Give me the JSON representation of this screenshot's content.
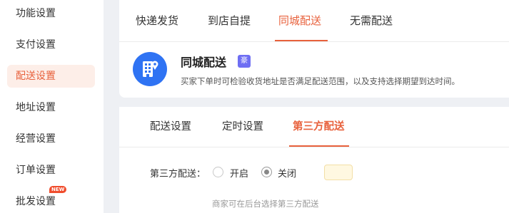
{
  "sidebar": {
    "items": [
      {
        "label": "功能设置",
        "active": false
      },
      {
        "label": "支付设置",
        "active": false
      },
      {
        "label": "配送设置",
        "active": true
      },
      {
        "label": "地址设置",
        "active": false
      },
      {
        "label": "经营设置",
        "active": false
      },
      {
        "label": "订单设置",
        "active": false
      },
      {
        "label": "批发设置",
        "active": false,
        "badge": "NEW"
      }
    ]
  },
  "top_tabs": [
    {
      "label": "快递发货",
      "active": false
    },
    {
      "label": "到店自提",
      "active": false
    },
    {
      "label": "同城配送",
      "active": true
    },
    {
      "label": "无需配送",
      "active": false
    }
  ],
  "feature": {
    "title": "同城配送",
    "tag": "豪",
    "description": "买家下单时可检验收货地址是否满足配送范围，以及支持选择期望到达时间。",
    "icon": "building-icon",
    "icon_color": "#2f73f3"
  },
  "sub_tabs": [
    {
      "label": "配送设置",
      "active": false
    },
    {
      "label": "定时设置",
      "active": false
    },
    {
      "label": "第三方配送",
      "active": true
    }
  ],
  "third_party": {
    "label": "第三方配送：",
    "options": [
      {
        "label": "开启",
        "checked": false
      },
      {
        "label": "关闭",
        "checked": true
      }
    ],
    "hint": "商家可在后台选择第三方配送"
  },
  "colors": {
    "accent": "#e8613c",
    "active_bg": "#fdeee8",
    "page_bg": "#eef0f4"
  }
}
